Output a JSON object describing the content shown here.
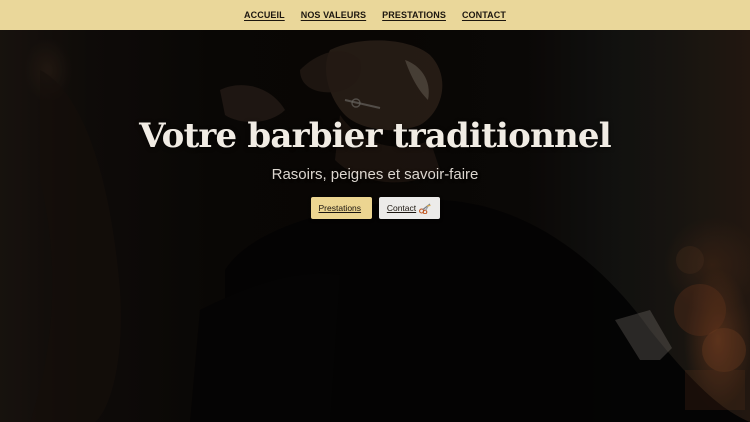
{
  "nav": {
    "items": [
      {
        "label": "ACCUEIL"
      },
      {
        "label": "NOS VALEURS"
      },
      {
        "label": "PRESTATIONS"
      },
      {
        "label": "CONTACT"
      }
    ]
  },
  "hero": {
    "title": "Votre barbier traditionnel",
    "subtitle": "Rasoirs, peignes et savoir-faire",
    "buttons": {
      "primary": {
        "label": "Prestations",
        "icon": "shaving-brush-icon"
      },
      "secondary": {
        "label": "Contact",
        "icon": "scissors-icon"
      }
    }
  },
  "colors": {
    "nav_background": "#ead79a",
    "primary_button": "#ecd591",
    "secondary_button": "#ecebe9",
    "title_text": "#f1ece4"
  }
}
